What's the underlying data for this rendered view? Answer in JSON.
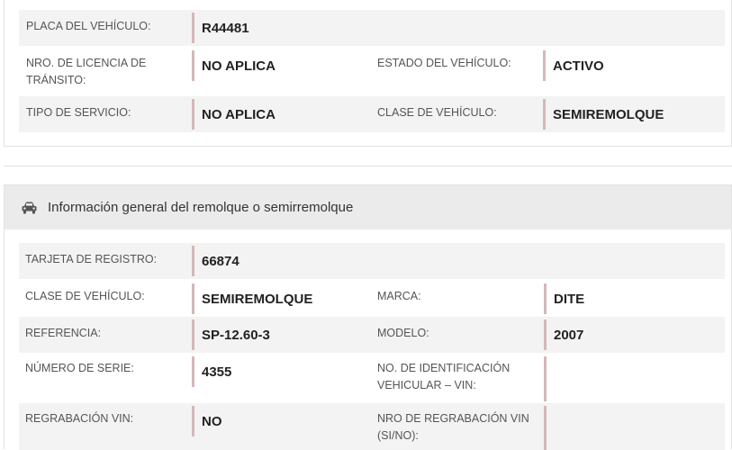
{
  "vehicle": {
    "placa_label": "PLACA DEL VEHÍCULO:",
    "placa_value": "R44481",
    "licencia_label": "NRO. DE LICENCIA DE TRÁNSITO:",
    "licencia_value": "NO APLICA",
    "estado_label": "ESTADO DEL VEHÍCULO:",
    "estado_value": "ACTIVO",
    "servicio_label": "TIPO DE SERVICIO:",
    "servicio_value": "NO APLICA",
    "clase_label": "CLASE DE VEHÍCULO:",
    "clase_value": "SEMIREMOLQUE"
  },
  "trailer": {
    "section_title": "Información general del remolque o semirremolque",
    "section_icon": "car-icon",
    "tarjeta_label": "TARJETA DE REGISTRO:",
    "tarjeta_value": "66874",
    "clase_label": "CLASE DE VEHÍCULO:",
    "clase_value": "SEMIREMOLQUE",
    "marca_label": "MARCA:",
    "marca_value": "DITE",
    "referencia_label": "REFERENCIA:",
    "referencia_value": "SP-12.60-3",
    "modelo_label": "MODELO:",
    "modelo_value": "2007",
    "serie_label": "NÚMERO DE SERIE:",
    "serie_value": "4355",
    "vin_label": "NO. DE IDENTIFICACIÓN VEHICULAR – VIN:",
    "vin_value": "",
    "regrabacion_label": "REGRABACIÓN VIN:",
    "regrabacion_value": "NO",
    "nro_regrabacion_label": "NRO DE REGRABACIÓN VIN (SI/NO):",
    "nro_regrabacion_value": ""
  },
  "colors": {
    "row_shade": "#f3f3f3",
    "header_bg": "#ebebeb",
    "value_border": "#d6b7b9"
  }
}
